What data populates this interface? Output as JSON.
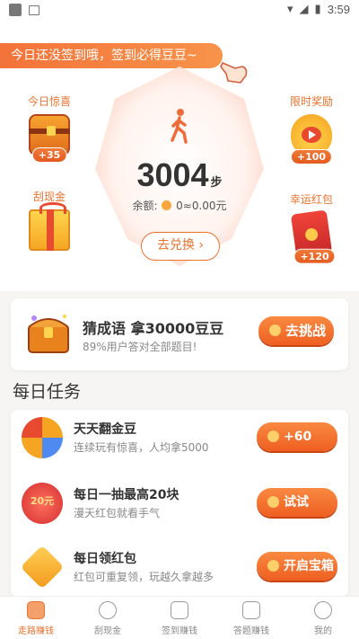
{
  "status_bar": {
    "time": "3:59"
  },
  "banner": {
    "text": "今日还没签到哦，签到必得豆豆~"
  },
  "side_rewards": [
    {
      "label": "今日惊喜",
      "badge": "+35",
      "icon": "treasure-chest-icon"
    },
    {
      "label": "刮现金",
      "badge": "",
      "icon": "gift-box-icon"
    },
    {
      "label": "限时奖励",
      "badge": "+100",
      "icon": "coin-pouch-icon"
    },
    {
      "label": "幸运红包",
      "badge": "+120",
      "icon": "red-envelope-icon"
    }
  ],
  "steps": {
    "count": "3004",
    "unit": "步",
    "balance_label": "余额:",
    "balance_value": "0≈0.00元",
    "exchange_label": "去兑换"
  },
  "idiom": {
    "title": "猜成语 拿30000豆豆",
    "subtitle": "89%用户答对全部题目!",
    "button": "去挑战"
  },
  "daily": {
    "title": "每日任务",
    "tasks": [
      {
        "title": "天天翻金豆",
        "subtitle": "连续玩有惊喜，人均拿5000",
        "button": "+60"
      },
      {
        "title": "每日一抽最高20块",
        "subtitle": "漫天红包就看手气",
        "button": "试试",
        "icon_text": "20元"
      },
      {
        "title": "每日领红包",
        "subtitle": "红包可重复领，玩越久拿越多",
        "button": "开启宝箱"
      }
    ]
  },
  "nav": [
    {
      "label": "走路赚钱",
      "active": true
    },
    {
      "label": "刮现金",
      "active": false
    },
    {
      "label": "签到赚钱",
      "active": false
    },
    {
      "label": "答题赚钱",
      "active": false
    },
    {
      "label": "我的",
      "active": false
    }
  ],
  "colors": {
    "accent": "#e8722e",
    "button": "#ee5f22"
  }
}
